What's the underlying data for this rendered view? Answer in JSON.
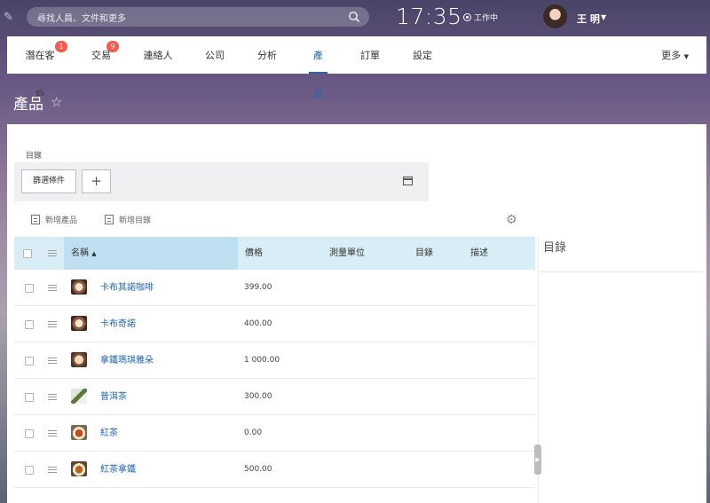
{
  "header": {
    "search_placeholder": "尋找人員、文件和更多",
    "time": "17:35",
    "work_status": "工作中",
    "user_name": "王 明"
  },
  "tabs": [
    {
      "label": "潛在客戶",
      "badge": "1"
    },
    {
      "label": "交易",
      "badge": "9"
    },
    {
      "label": "連絡人"
    },
    {
      "label": "公司"
    },
    {
      "label": "分析"
    },
    {
      "label": "產品",
      "active": true
    },
    {
      "label": "訂單"
    },
    {
      "label": "設定"
    }
  ],
  "more_label": "更多",
  "page": {
    "title": "產品"
  },
  "filter": {
    "section_label": "目錄",
    "filter_button": "篩選條件",
    "add_button": "+"
  },
  "actions": {
    "new_product": "新增產品",
    "new_catalog": "新增目錄"
  },
  "table": {
    "columns": [
      "名稱",
      "價格",
      "測量單位",
      "目錄",
      "描述"
    ],
    "rows": [
      {
        "name": "卡布其諾咖啡",
        "price": "399.00",
        "thumb": "cappuccino"
      },
      {
        "name": "卡布奇諾",
        "price": "400.00",
        "thumb": "cappuccino"
      },
      {
        "name": "拿鐵瑪琪雅朵",
        "price": "1 000.00",
        "thumb": "latte"
      },
      {
        "name": "普洱茶",
        "price": "300.00",
        "thumb": "puer"
      },
      {
        "name": "紅茶",
        "price": "0.00",
        "thumb": "tea"
      },
      {
        "name": "紅茶拿鐵",
        "price": "500.00",
        "thumb": "milktea"
      }
    ]
  },
  "side_panel": {
    "title": "目錄"
  }
}
